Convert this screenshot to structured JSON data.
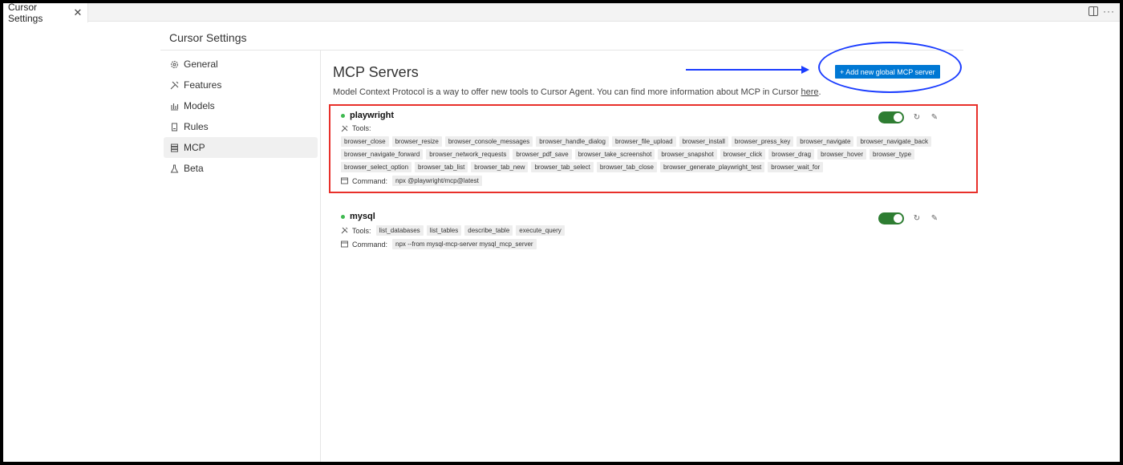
{
  "tab": {
    "label": "Cursor Settings",
    "close": "✕"
  },
  "toolbar": {
    "more": "···"
  },
  "header": {
    "title": "Cursor Settings"
  },
  "sidebar": {
    "items": [
      {
        "label": "General",
        "icon": "gear-icon"
      },
      {
        "label": "Features",
        "icon": "tools-icon"
      },
      {
        "label": "Models",
        "icon": "bar-chart-icon"
      },
      {
        "label": "Rules",
        "icon": "document-icon"
      },
      {
        "label": "MCP",
        "icon": "server-icon",
        "active": true
      },
      {
        "label": "Beta",
        "icon": "flask-icon"
      }
    ]
  },
  "main": {
    "title": "MCP Servers",
    "description": "Model Context Protocol is a way to offer new tools to Cursor Agent. You can find more information about MCP in Cursor ",
    "description_link": "here",
    "description_end": ".",
    "add_button": "+ Add new global MCP server"
  },
  "servers": [
    {
      "name": "playwright",
      "tools_label": "Tools:",
      "tools": [
        "browser_close",
        "browser_resize",
        "browser_console_messages",
        "browser_handle_dialog",
        "browser_file_upload",
        "browser_install",
        "browser_press_key",
        "browser_navigate",
        "browser_navigate_back",
        "browser_navigate_forward",
        "browser_network_requests",
        "browser_pdf_save",
        "browser_take_screenshot",
        "browser_snapshot",
        "browser_click",
        "browser_drag",
        "browser_hover",
        "browser_type",
        "browser_select_option",
        "browser_tab_list",
        "browser_tab_new",
        "browser_tab_select",
        "browser_tab_close",
        "browser_generate_playwright_test",
        "browser_wait_for"
      ],
      "command_label": "Command:",
      "command": "npx @playwright/mcp@latest",
      "enabled": true
    },
    {
      "name": "mysql",
      "tools_label": "Tools:",
      "tools": [
        "list_databases",
        "list_tables",
        "describe_table",
        "execute_query"
      ],
      "command_label": "Command:",
      "command": "npx --from mysql-mcp-server mysql_mcp_server",
      "enabled": true
    }
  ],
  "colors": {
    "accent": "#0078d4",
    "toggle_on": "#2e7d32",
    "status_dot": "#3fb950",
    "annotation_red": "#e8302a",
    "annotation_blue": "#1a3cff"
  }
}
